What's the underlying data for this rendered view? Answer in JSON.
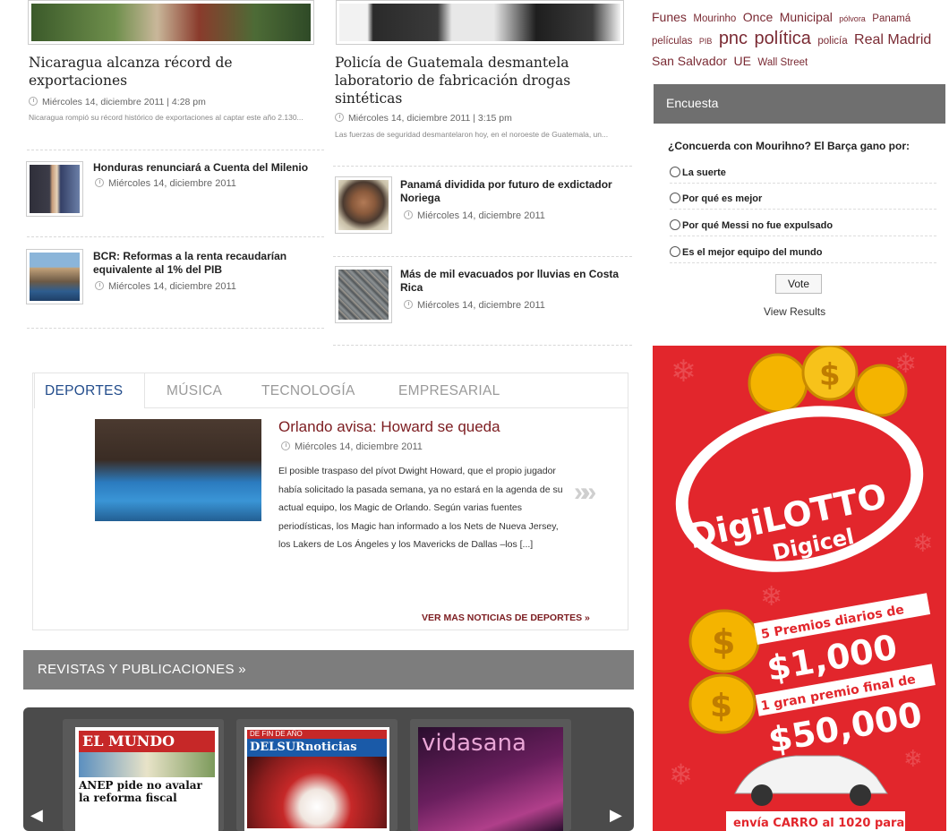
{
  "news": {
    "left_main": {
      "title": "Nicaragua alcanza récord de exportaciones",
      "date": "Miércoles 14, diciembre 2011 | 4:28 pm",
      "excerpt": "Nicaragua rompió su récord histórico de exportaciones al captar este año 2.130..."
    },
    "right_main": {
      "title": "Policía de Guatemala desmantela laboratorio de fabricación drogas sintéticas",
      "date": "Miércoles 14, diciembre 2011 | 3:15 pm",
      "excerpt": "Las fuerzas de seguridad desmantelaron hoy, en el noroeste de Guatemala, un..."
    },
    "left_items": [
      {
        "title": "Honduras renunciará a Cuenta del Milenio",
        "date": "Miércoles 14, diciembre 2011"
      },
      {
        "title": "BCR: Reformas a la renta recaudarían equivalente al 1% del PIB",
        "date": "Miércoles 14, diciembre 2011"
      }
    ],
    "right_items": [
      {
        "title": "Panamá dividida por futuro de exdictador Noriega",
        "date": "Miércoles 14, diciembre 2011"
      },
      {
        "title": "Más de mil evacuados por lluvias en Costa Rica",
        "date": "Miércoles 14, diciembre 2011"
      }
    ]
  },
  "tags": [
    {
      "text": "Funes",
      "size": "m"
    },
    {
      "text": "Mourinho",
      "size": "s"
    },
    {
      "text": "Once",
      "size": "m"
    },
    {
      "text": "Municipal",
      "size": "m"
    },
    {
      "text": "pólvora",
      "size": "xs"
    },
    {
      "text": "Panamá",
      "size": "s"
    },
    {
      "text": "películas",
      "size": "s"
    },
    {
      "text": "PIB",
      "size": "xs"
    },
    {
      "text": "pnc",
      "size": "xl"
    },
    {
      "text": "política",
      "size": "xl"
    },
    {
      "text": "policía",
      "size": "s"
    },
    {
      "text": "Real Madrid",
      "size": "l"
    },
    {
      "text": "San Salvador",
      "size": "m"
    },
    {
      "text": "UE",
      "size": "m"
    },
    {
      "text": "Wall Street",
      "size": "s"
    }
  ],
  "poll": {
    "heading": "Encuesta",
    "question": "¿Concuerda con Mourihno? El Barça gano por:",
    "options": [
      "La suerte",
      "Por qué es mejor",
      "Por qué Messi no fue expulsado",
      "Es el mejor equipo del mundo"
    ],
    "vote_label": "Vote",
    "view_results": "View Results"
  },
  "ad": {
    "brand_top": "DigiLOTTO",
    "brand_bottom": "Digicel",
    "line1": "5 Premios diarios de",
    "amount1": "$1,000",
    "line2": "1 gran premio final de",
    "amount2": "$50,000",
    "cta": "envía CARRO al 1020 para"
  },
  "tabs": {
    "items": [
      "DEPORTES",
      "MÚSICA",
      "TECNOLOGÍA",
      "EMPRESARIAL"
    ],
    "feature_title": "Orlando avisa: Howard se queda",
    "feature_date": "Miércoles 14, diciembre 2011",
    "feature_text": "El posible traspaso del pívot Dwight Howard, que el propio jugador había solicitado la pasada semana, ya no estará en la agenda de su actual equipo, los Magic de Orlando. Según varias fuentes periodísticas, los Magic han informado a los Nets de Nueva Jersey, los Lakers de Los Ángeles y los Mavericks de Dallas –los [...]",
    "more_link": "VER MAS NOTICIAS DE DEPORTES »"
  },
  "magazines": {
    "heading": "REVISTAS Y PUBLICACIONES »",
    "covers": [
      {
        "name": "EL MUNDO",
        "headline": "ANEP pide no avalar la reforma fiscal"
      },
      {
        "name": "DELSURnoticias",
        "headline": "DE FIN DE AÑO"
      },
      {
        "name": "vidasana",
        "headline": ""
      }
    ]
  },
  "colors": {
    "accent": "#7c1c20",
    "tab_active": "#234d8c",
    "poll_header": "#6f6f6f",
    "ad_red": "#e2262c"
  }
}
